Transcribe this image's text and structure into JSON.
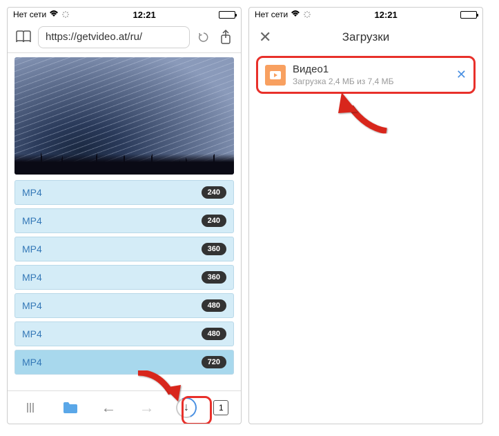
{
  "status": {
    "carrier": "Нет сети",
    "time": "12:21"
  },
  "left": {
    "url": "https://getvideo.at/ru/",
    "formats": [
      {
        "label": "MP4",
        "quality": "240",
        "selected": false
      },
      {
        "label": "MP4",
        "quality": "240",
        "selected": false
      },
      {
        "label": "MP4",
        "quality": "360",
        "selected": false
      },
      {
        "label": "MP4",
        "quality": "360",
        "selected": false
      },
      {
        "label": "MP4",
        "quality": "480",
        "selected": false
      },
      {
        "label": "MP4",
        "quality": "480",
        "selected": false
      },
      {
        "label": "MP4",
        "quality": "720",
        "selected": true
      }
    ],
    "tabs_count": "1"
  },
  "right": {
    "title": "Загрузки",
    "item": {
      "name": "Видео1",
      "status": "Загрузка 2,4 МБ из 7,4 МБ"
    }
  }
}
